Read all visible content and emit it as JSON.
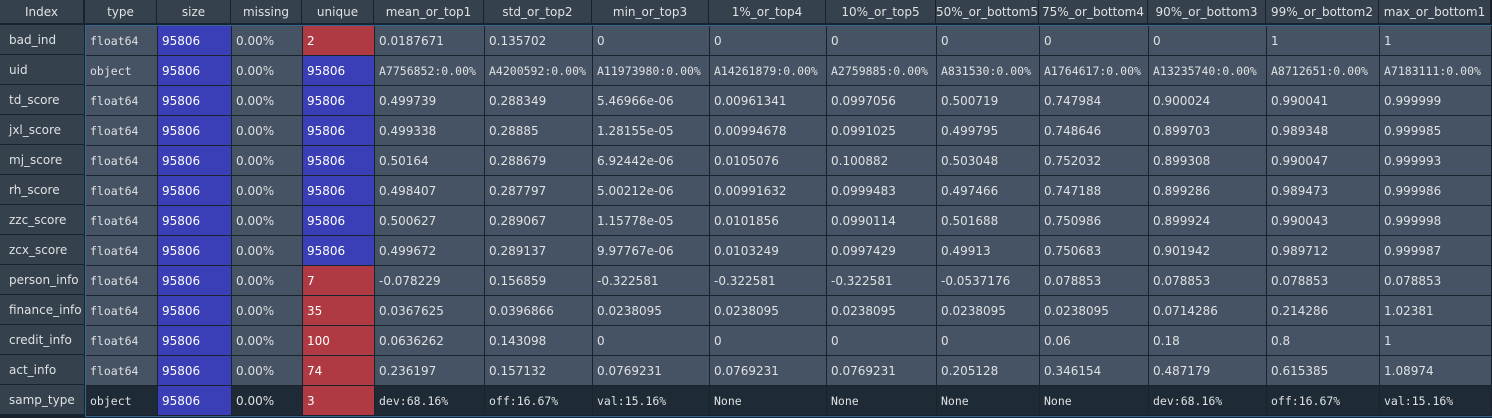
{
  "corner_label": "Index",
  "columns": [
    "type",
    "size",
    "missing",
    "unique",
    "mean_or_top1",
    "std_or_top2",
    "min_or_top3",
    "1%_or_top4",
    "10%_or_top5",
    "50%_or_bottom5",
    "75%_or_bottom4",
    "90%_or_bottom3",
    "99%_or_bottom2",
    "max_or_bottom1"
  ],
  "rows": [
    {
      "index": "bad_ind",
      "cells": [
        "float64",
        "95806",
        "0.00%",
        "2",
        "0.0187671",
        "0.135702",
        "0",
        "0",
        "0",
        "0",
        "0",
        "0",
        "1",
        "1"
      ],
      "unique_color": "red"
    },
    {
      "index": "uid",
      "cells": [
        "object",
        "95806",
        "0.00%",
        "95806",
        "A7756852:0.00%",
        "A4200592:0.00%",
        "A11973980:0.00%",
        "A14261879:0.00%",
        "A2759885:0.00%",
        "A831530:0.00%",
        "A1764617:0.00%",
        "A13235740:0.00%",
        "A8712651:0.00%",
        "A7183111:0.00%"
      ],
      "unique_color": "blue"
    },
    {
      "index": "td_score",
      "cells": [
        "float64",
        "95806",
        "0.00%",
        "95806",
        "0.499739",
        "0.288349",
        "5.46966e-06",
        "0.00961341",
        "0.0997056",
        "0.500719",
        "0.747984",
        "0.900024",
        "0.990041",
        "0.999999"
      ],
      "unique_color": "blue"
    },
    {
      "index": "jxl_score",
      "cells": [
        "float64",
        "95806",
        "0.00%",
        "95806",
        "0.499338",
        "0.28885",
        "1.28155e-05",
        "0.00994678",
        "0.0991025",
        "0.499795",
        "0.748646",
        "0.899703",
        "0.989348",
        "0.999985"
      ],
      "unique_color": "blue"
    },
    {
      "index": "mj_score",
      "cells": [
        "float64",
        "95806",
        "0.00%",
        "95806",
        "0.50164",
        "0.288679",
        "6.92442e-06",
        "0.0105076",
        "0.100882",
        "0.503048",
        "0.752032",
        "0.899308",
        "0.990047",
        "0.999993"
      ],
      "unique_color": "blue"
    },
    {
      "index": "rh_score",
      "cells": [
        "float64",
        "95806",
        "0.00%",
        "95806",
        "0.498407",
        "0.287797",
        "5.00212e-06",
        "0.00991632",
        "0.0999483",
        "0.497466",
        "0.747188",
        "0.899286",
        "0.989473",
        "0.999986"
      ],
      "unique_color": "blue"
    },
    {
      "index": "zzc_score",
      "cells": [
        "float64",
        "95806",
        "0.00%",
        "95806",
        "0.500627",
        "0.289067",
        "1.15778e-05",
        "0.0101856",
        "0.0990114",
        "0.501688",
        "0.750986",
        "0.899924",
        "0.990043",
        "0.999998"
      ],
      "unique_color": "blue"
    },
    {
      "index": "zcx_score",
      "cells": [
        "float64",
        "95806",
        "0.00%",
        "95806",
        "0.499672",
        "0.289137",
        "9.97767e-06",
        "0.0103249",
        "0.0997429",
        "0.49913",
        "0.750683",
        "0.901942",
        "0.989712",
        "0.999987"
      ],
      "unique_color": "blue"
    },
    {
      "index": "person_info",
      "cells": [
        "float64",
        "95806",
        "0.00%",
        "7",
        "-0.078229",
        "0.156859",
        "-0.322581",
        "-0.322581",
        "-0.322581",
        "-0.0537176",
        "0.078853",
        "0.078853",
        "0.078853",
        "0.078853"
      ],
      "unique_color": "red"
    },
    {
      "index": "finance_info",
      "cells": [
        "float64",
        "95806",
        "0.00%",
        "35",
        "0.0367625",
        "0.0396866",
        "0.0238095",
        "0.0238095",
        "0.0238095",
        "0.0238095",
        "0.0238095",
        "0.0714286",
        "0.214286",
        "1.02381"
      ],
      "unique_color": "red"
    },
    {
      "index": "credit_info",
      "cells": [
        "float64",
        "95806",
        "0.00%",
        "100",
        "0.0636262",
        "0.143098",
        "0",
        "0",
        "0",
        "0",
        "0.06",
        "0.18",
        "0.8",
        "1"
      ],
      "unique_color": "red"
    },
    {
      "index": "act_info",
      "cells": [
        "float64",
        "95806",
        "0.00%",
        "74",
        "0.236197",
        "0.157132",
        "0.0769231",
        "0.0769231",
        "0.0769231",
        "0.205128",
        "0.346154",
        "0.487179",
        "0.615385",
        "1.08974"
      ],
      "unique_color": "red"
    },
    {
      "index": "samp_type",
      "cells": [
        "object",
        "95806",
        "0.00%",
        "3",
        "dev:68.16%",
        "off:16.67%",
        "val:15.16%",
        "None",
        "None",
        "None",
        "None",
        "dev:68.16%",
        "off:16.67%",
        "val:15.16%"
      ],
      "unique_color": "red"
    }
  ],
  "colors": {
    "blue": "#3a3fb8",
    "red": "#b03a43",
    "cell_bg": "#455364",
    "header_bg": "#35414d",
    "selection_border": "#346792"
  }
}
